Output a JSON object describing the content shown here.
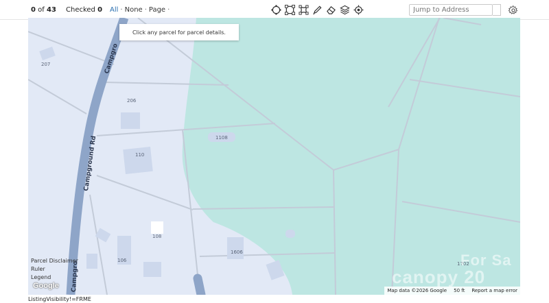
{
  "toolbar": {
    "count_value": "0",
    "count_of": "of",
    "count_total": "43",
    "checked_label": "Checked",
    "checked_value": "0",
    "select_all": "All",
    "select_none": "None",
    "select_page": "Page",
    "tools": [
      "circle-draw-icon",
      "polygon-draw-icon",
      "freeform-draw-icon",
      "pencil-icon",
      "eraser-icon",
      "layers-icon",
      "target-icon"
    ],
    "jump_placeholder": "Jump to Address"
  },
  "map": {
    "tooltip": "Click any parcel for parcel details.",
    "road_label_1": "Campground Rd",
    "road_label_2": "Campgro",
    "road_label_3": "Campgro",
    "parcels": [
      "207",
      "206",
      "110",
      "1108",
      "108",
      "106",
      "1606",
      "1702"
    ],
    "links": [
      "Parcel Disclaimer",
      "Ruler",
      "Legend"
    ],
    "google_logo": "Google",
    "attribution": "Map data ©2026 Google",
    "scale": "50 ft",
    "report_link": "Report a map error",
    "watermark": "canopy 20",
    "watermark_top": "For Sa",
    "colors": {
      "land": "#e2e9f6",
      "water_teal": "#bde6e2",
      "road": "#8ea5c8",
      "parcel_line": "#c3cbd8"
    }
  },
  "footer_text": "ListingVisibility!=FRME"
}
